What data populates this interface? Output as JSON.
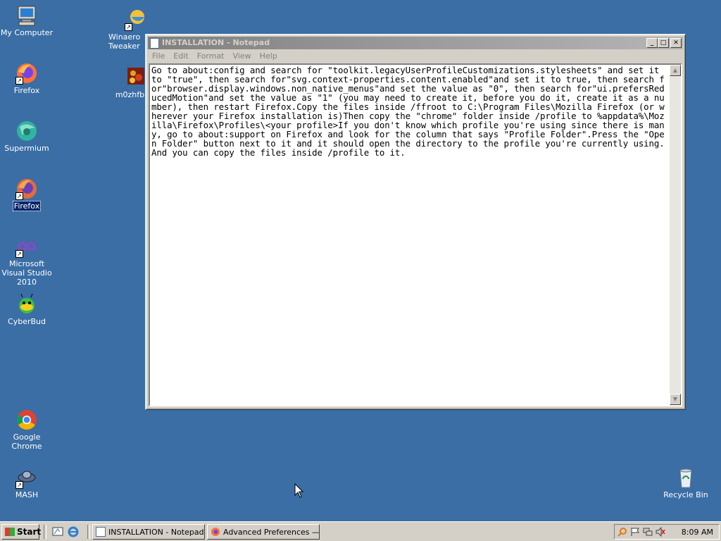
{
  "desktop": {
    "icons": [
      {
        "label": "My Computer"
      },
      {
        "label": "Firefox"
      },
      {
        "label": "Supermium"
      },
      {
        "label": "Firefox"
      },
      {
        "label": "Microsoft Visual Studio 2010"
      },
      {
        "label": "CyberBud"
      },
      {
        "label": "Google Chrome"
      },
      {
        "label": "MASH"
      },
      {
        "label": "Winaero Tweaker"
      },
      {
        "label": "m0zhfbiq6"
      },
      {
        "label": "Recycle Bin"
      }
    ]
  },
  "notepad": {
    "title": "INSTALLATION - Notepad",
    "menu": [
      "File",
      "Edit",
      "Format",
      "View",
      "Help"
    ],
    "content": "Go to about:config and search for \"toolkit.legacyUserProfileCustomizations.stylesheets\" and set it to \"true\", then search for\"svg.context-properties.content.enabled\"and set it to true, then search for\"browser.display.windows.non_native_menus\"and set the value as \"0\", then search for\"ui.prefersReducedMotion\"and set the value as \"1\" (you may need to create it, before you do it, create it as a number), then restart Firefox.Copy the files inside /ffroot to C:\\Program Files\\Mozilla Firefox (or wherever your Firefox installation is)Then copy the \"chrome\" folder inside /profile to %appdata%\\Mozilla\\Firefox\\Profiles\\<your profile>If you don't know which profile you're using since there is many, go to about:support on Firefox and look for the column that says \"Profile Folder\".Press the \"Open Folder\" button next to it and it should open the directory to the profile you're currently using. And you can copy the files inside /profile to it."
  },
  "taskbar": {
    "start_label": "Start",
    "tasks": [
      {
        "label": "INSTALLATION - Notepad"
      },
      {
        "label": "Advanced Preferences —..."
      }
    ],
    "clock": "8:09 AM"
  },
  "colors": {
    "desktop_bg": "#3a6ea5",
    "selection": "#0a246a"
  }
}
